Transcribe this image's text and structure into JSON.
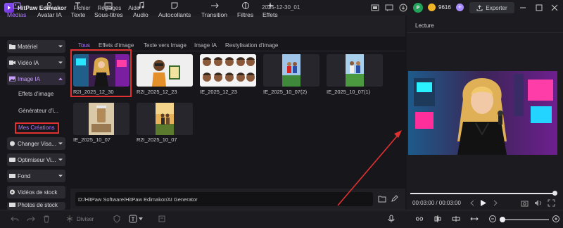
{
  "titlebar": {
    "app_name": "HitPaw Edimakor",
    "menus": [
      "Fichier",
      "Réglages",
      "Aide"
    ],
    "project_title": "2025-12-30_01",
    "avatar_letter": "P",
    "credits": "9616",
    "export_label": "Exporter"
  },
  "toolbar": {
    "tools": [
      "Médias",
      "Avatar IA",
      "Texte",
      "Sous-titres",
      "Audio",
      "Autocollants",
      "Transition",
      "Filtres",
      "Effets"
    ]
  },
  "sidebar": {
    "items": [
      "Matériel",
      "Vidéo IA",
      "Image IA",
      "Changer Visa...",
      "Optimiseur Vi...",
      "Fond",
      "Vidéos de stock",
      "Photos de stock"
    ],
    "subitems": [
      "Effets d'image",
      "Générateur d'i...",
      "Mes Créations"
    ]
  },
  "tabs": [
    "Tous",
    "Effets d'image",
    "Texte vers Image",
    "Image IA",
    "Restylisation d'image"
  ],
  "media": [
    {
      "label": "R2I_2025_12_30"
    },
    {
      "label": "R2I_2025_12_23"
    },
    {
      "label": "IE_2025_12_23"
    },
    {
      "label": "IE_2025_10_07(2)"
    },
    {
      "label": "IE_2025_10_07(1)"
    },
    {
      "label": "IE_2025_10_07"
    },
    {
      "label": "R2I_2025_10_07"
    }
  ],
  "path": "D:/HitPaw Software/HitPaw Edimakor/AI Generator",
  "preview": {
    "title": "Lecture",
    "time": "00:03:00 / 00:03:00",
    "progress": 1.0
  },
  "bottom": {
    "split_label": "Diviser"
  },
  "colors": {
    "accent": "#b07bff",
    "highlight": "#e03131"
  }
}
